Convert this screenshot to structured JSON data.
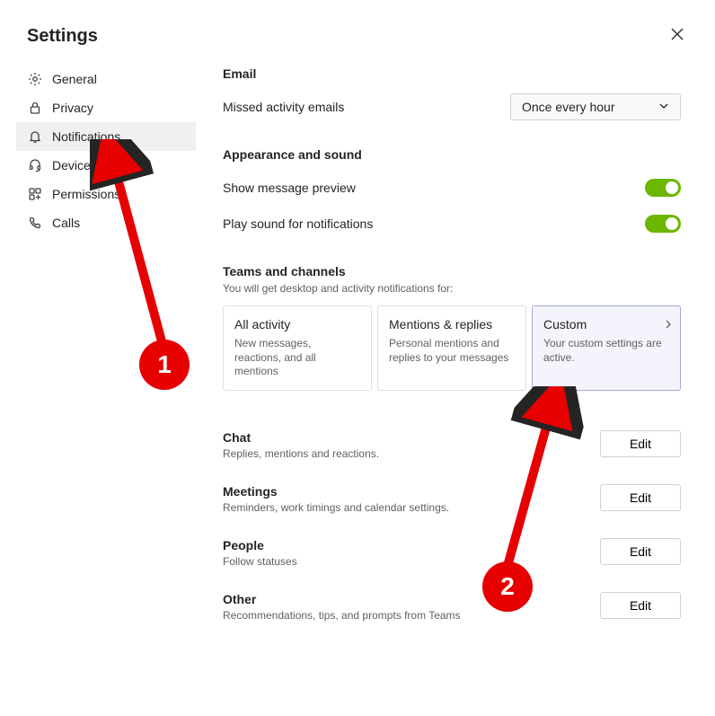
{
  "header": {
    "title": "Settings"
  },
  "sidebar": {
    "items": [
      {
        "label": "General"
      },
      {
        "label": "Privacy"
      },
      {
        "label": "Notifications"
      },
      {
        "label": "Devices"
      },
      {
        "label": "Permissions"
      },
      {
        "label": "Calls"
      }
    ]
  },
  "email": {
    "title": "Email",
    "missed_label": "Missed activity emails",
    "missed_value": "Once every hour"
  },
  "appearance": {
    "title": "Appearance and sound",
    "preview_label": "Show message preview",
    "sound_label": "Play sound for notifications"
  },
  "teams": {
    "title": "Teams and channels",
    "subtitle": "You will get desktop and activity notifications for:",
    "cards": [
      {
        "title": "All activity",
        "desc": "New messages, reactions, and all mentions"
      },
      {
        "title": "Mentions & replies",
        "desc": "Personal mentions and replies to your messages"
      },
      {
        "title": "Custom",
        "desc": "Your custom settings are active."
      }
    ]
  },
  "edit_sections": [
    {
      "title": "Chat",
      "desc": "Replies, mentions and reactions.",
      "btn": "Edit"
    },
    {
      "title": "Meetings",
      "desc": "Reminders, work timings and calendar settings.",
      "btn": "Edit"
    },
    {
      "title": "People",
      "desc": "Follow statuses",
      "btn": "Edit"
    },
    {
      "title": "Other",
      "desc": "Recommendations, tips, and prompts from Teams",
      "btn": "Edit"
    }
  ],
  "annotations": {
    "one": "1",
    "two": "2"
  }
}
